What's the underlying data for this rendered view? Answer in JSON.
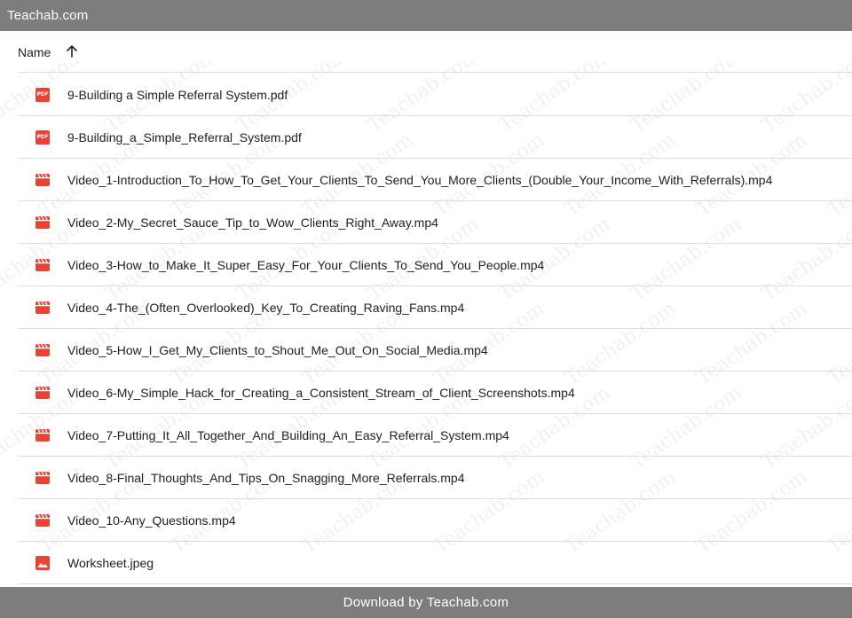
{
  "header_bar": {
    "title": "Teachab.com"
  },
  "list_header": {
    "name_label": "Name",
    "sort_icon": "arrow-up-icon"
  },
  "files": [
    {
      "name": "9-Building a Simple Referral System.pdf",
      "type": "pdf"
    },
    {
      "name": "9-Building_a_Simple_Referral_System.pdf",
      "type": "pdf"
    },
    {
      "name": "Video_1-Introduction_To_How_To_Get_Your_Clients_To_Send_You_More_Clients_(Double_Your_Income_With_Referrals).mp4",
      "type": "video"
    },
    {
      "name": "Video_2-My_Secret_Sauce_Tip_to_Wow_Clients_Right_Away.mp4",
      "type": "video"
    },
    {
      "name": "Video_3-How_to_Make_It_Super_Easy_For_Your_Clients_To_Send_You_People.mp4",
      "type": "video"
    },
    {
      "name": "Video_4-The_(Often_Overlooked)_Key_To_Creating_Raving_Fans.mp4",
      "type": "video"
    },
    {
      "name": "Video_5-How_I_Get_My_Clients_to_Shout_Me_Out_On_Social_Media.mp4",
      "type": "video"
    },
    {
      "name": "Video_6-My_Simple_Hack_for_Creating_a_Consistent_Stream_of_Client_Screenshots.mp4",
      "type": "video"
    },
    {
      "name": "Video_7-Putting_It_All_Together_And_Building_An_Easy_Referral_System.mp4",
      "type": "video"
    },
    {
      "name": "Video_8-Final_Thoughts_And_Tips_On_Snagging_More_Referrals.mp4",
      "type": "video"
    },
    {
      "name": "Video_10-Any_Questions.mp4",
      "type": "video"
    },
    {
      "name": "Worksheet.jpeg",
      "type": "image"
    }
  ],
  "icons": {
    "pdf": "pdf-icon",
    "video": "video-file-icon",
    "image": "image-file-icon"
  },
  "pdf_badge_text": "PDF",
  "footer_bar": {
    "text": "Download by Teachab.com"
  },
  "watermark_text": "Teachab.com",
  "colors": {
    "bar_bg": "#7d7d7d",
    "icon_red": "#ea4335",
    "divider": "#dadce0"
  }
}
